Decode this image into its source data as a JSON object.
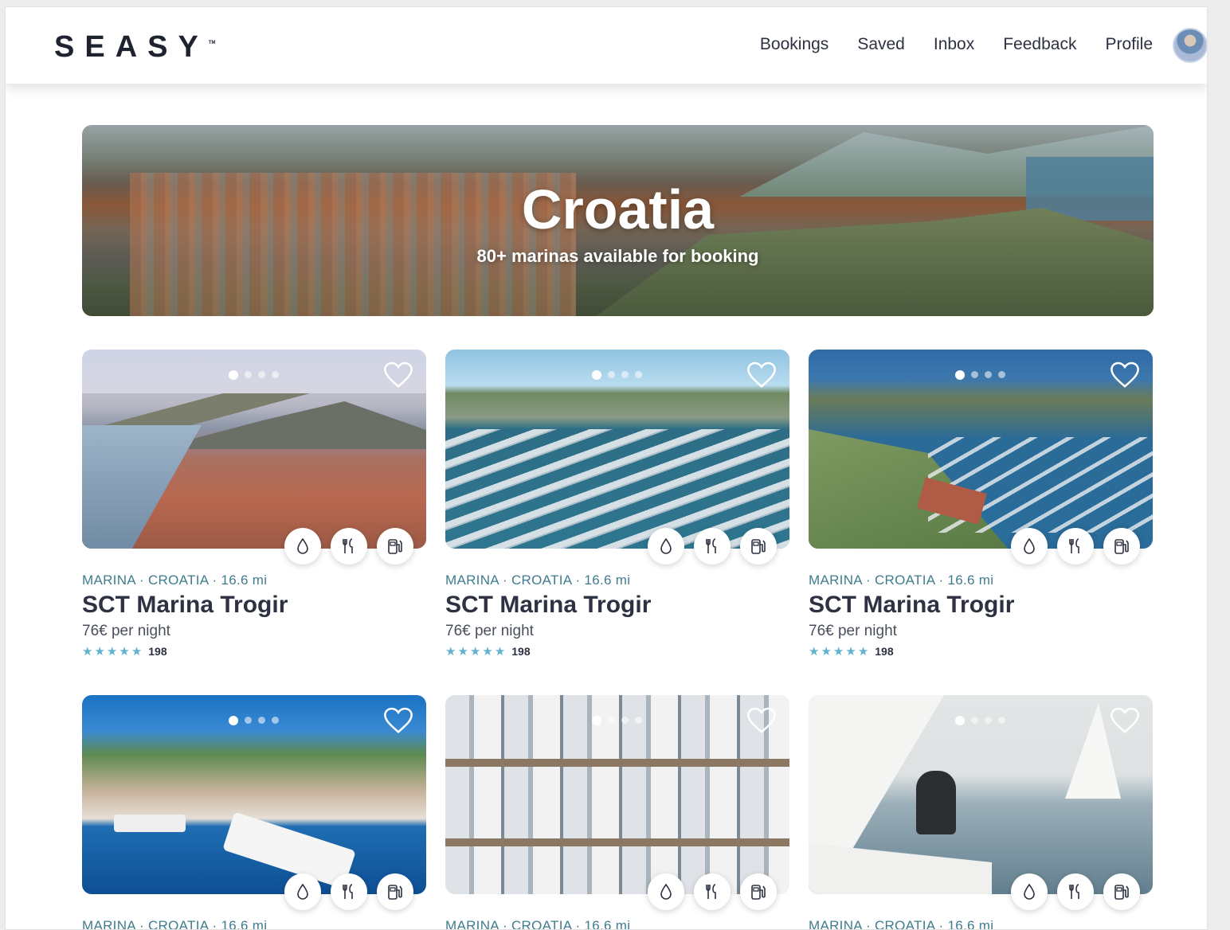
{
  "header": {
    "logo": "SEASY",
    "logo_tm": "TM",
    "nav": [
      "Bookings",
      "Saved",
      "Inbox",
      "Feedback",
      "Profile"
    ]
  },
  "hero": {
    "title": "Croatia",
    "subtitle": "80+ marinas available for booking"
  },
  "cards": [
    {
      "meta": "MARINA · CROATIA · 16.6 mi",
      "title": "SCT Marina Trogir",
      "price": "76€ per night",
      "reviews": "198",
      "rating": 5
    },
    {
      "meta": "MARINA · CROATIA · 16.6 mi",
      "title": "SCT Marina Trogir",
      "price": "76€ per night",
      "reviews": "198",
      "rating": 5
    },
    {
      "meta": "MARINA · CROATIA · 16.6 mi",
      "title": "SCT Marina Trogir",
      "price": "76€ per night",
      "reviews": "198",
      "rating": 5
    },
    {
      "meta": "MARINA · CROATIA · 16.6 mi"
    },
    {
      "meta": "MARINA · CROATIA · 16.6 mi"
    },
    {
      "meta": "MARINA · CROATIA · 16.6 mi"
    }
  ],
  "amenities": [
    "water-icon",
    "restaurant-icon",
    "fuel-icon"
  ],
  "colors": {
    "accent": "#5fb3cc",
    "meta": "#3f7c8f",
    "text": "#2d3142"
  }
}
